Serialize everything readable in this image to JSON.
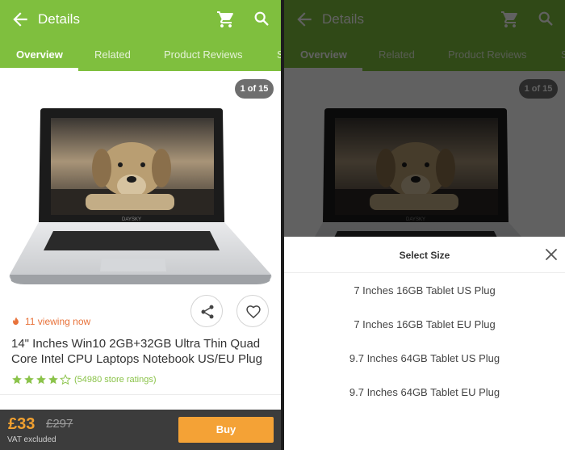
{
  "header": {
    "title": "Details",
    "back_icon": "arrow-left-icon",
    "cart_icon": "cart-icon",
    "search_icon": "search-icon"
  },
  "tabs": [
    {
      "label": "Overview",
      "active": true
    },
    {
      "label": "Related",
      "active": false
    },
    {
      "label": "Product Reviews",
      "active": false
    },
    {
      "label": "S",
      "active": false
    }
  ],
  "gallery": {
    "counter": "1 of 15",
    "screen_logo": "DAYSKY"
  },
  "product": {
    "viewing_now": "11 viewing now",
    "title": "14\" Inches Win10 2GB+32GB Ultra Thin Quad Core Intel CPU Laptops Notebook US/EU Plug",
    "rating_stars": 4,
    "rating_max": 5,
    "rating_count": "(54980 store ratings)"
  },
  "purchase": {
    "price": "£33",
    "old_price": "£297",
    "vat_note": "VAT excluded",
    "buy_label": "Buy"
  },
  "size_sheet": {
    "title": "Select Size",
    "options": [
      "7 Inches 16GB Tablet US Plug",
      "7 Inches 16GB Tablet EU Plug",
      "9.7 Inches 64GB Tablet US Plug",
      "9.7 Inches 64GB Tablet EU Plug"
    ]
  },
  "colors": {
    "brand_green": "#7fbf3e",
    "price_orange": "#f0a030",
    "buy_button": "#f4a236",
    "viewing_red": "#e8723a",
    "star_green": "#8bc34a"
  }
}
